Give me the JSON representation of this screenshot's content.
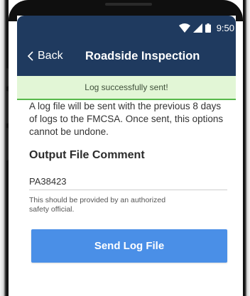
{
  "status_bar": {
    "time": "9:50",
    "icons": [
      "wifi-icon",
      "signal-icon",
      "battery-icon"
    ]
  },
  "app_bar": {
    "back_label": "Back",
    "title": "Roadside Inspection"
  },
  "toast": {
    "message": "Log successfully sent!"
  },
  "content": {
    "description": "A log file will be sent with the previous 8 days of logs to the FMCSA. Once sent, this options cannot be undone.",
    "section_title": "Output File Comment",
    "comment_value": "PA38423",
    "hint": "This should be provided by an authorized safety official.",
    "send_label": "Send Log File"
  },
  "colors": {
    "app_bar": "#1f3a5f",
    "toast_bg": "#e2f6d6",
    "toast_border": "#57b84a",
    "primary_button": "#4a8fe7"
  }
}
